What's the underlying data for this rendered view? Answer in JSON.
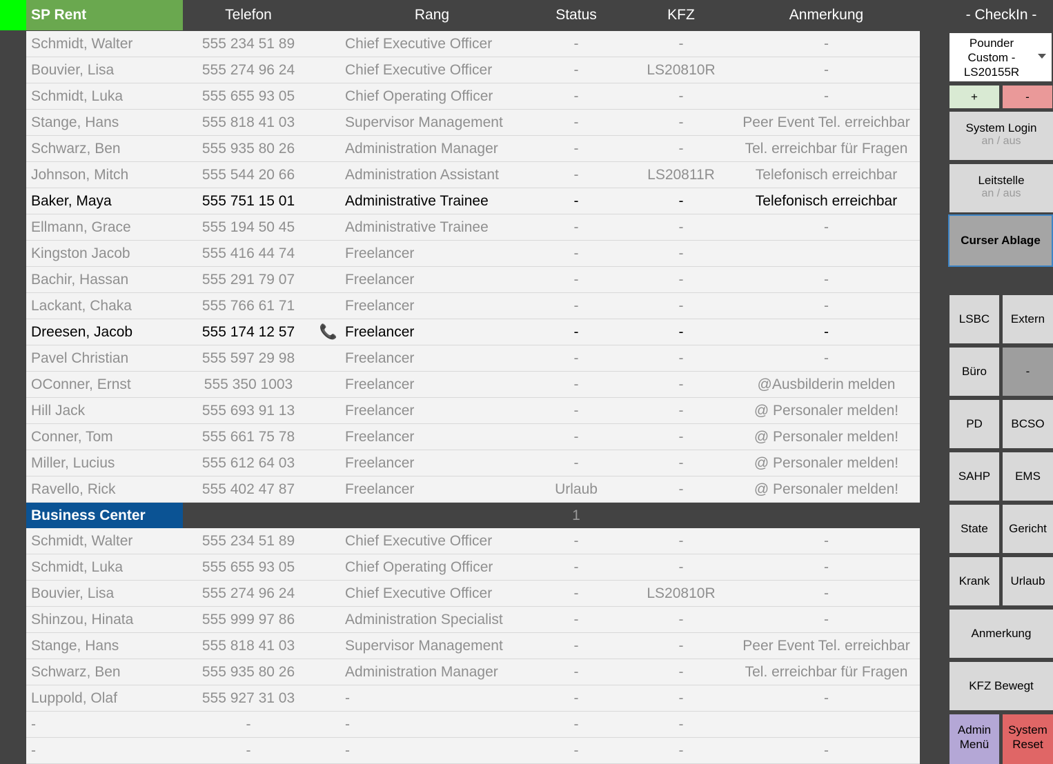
{
  "header": {
    "brand": "SP Rent",
    "columns": [
      "Telefon",
      "Rang",
      "Status",
      "KFZ",
      "Anmerkung"
    ]
  },
  "sp_rows": [
    {
      "name": "Schmidt, Walter",
      "tel": "555 234 51 89",
      "icon": "",
      "rang": "Chief Executive Officer",
      "status": "-",
      "kfz": "-",
      "note": "-",
      "active": false
    },
    {
      "name": "Bouvier, Lisa",
      "tel": "555 274 96 24",
      "icon": "",
      "rang": "Chief Executive Officer",
      "status": "-",
      "kfz": "LS20810R",
      "note": "-",
      "active": false
    },
    {
      "name": "Schmidt, Luka",
      "tel": "555 655 93 05",
      "icon": "",
      "rang": "Chief Operating Officer",
      "status": "-",
      "kfz": "-",
      "note": "-",
      "active": false
    },
    {
      "name": "Stange, Hans",
      "tel": "555 818 41 03",
      "icon": "",
      "rang": "Supervisor Management",
      "status": "-",
      "kfz": "-",
      "note": "Peer Event Tel. erreichbar",
      "active": false
    },
    {
      "name": "Schwarz, Ben",
      "tel": "555 935 80 26",
      "icon": "",
      "rang": "Administration Manager",
      "status": "-",
      "kfz": "-",
      "note": "Tel. erreichbar für Fragen",
      "active": false
    },
    {
      "name": "Johnson, Mitch",
      "tel": "555 544 20 66",
      "icon": "",
      "rang": "Administration Assistant",
      "status": "-",
      "kfz": "LS20811R",
      "note": "Telefonisch erreichbar",
      "active": false
    },
    {
      "name": "Baker, Maya",
      "tel": "555 751 15 01",
      "icon": "",
      "rang": "Administrative Trainee",
      "status": "-",
      "kfz": "-",
      "note": "Telefonisch erreichbar",
      "active": true
    },
    {
      "name": "Ellmann, Grace",
      "tel": "555 194 50 45",
      "icon": "",
      "rang": "Administrative Trainee",
      "status": "-",
      "kfz": "-",
      "note": "-",
      "active": false
    },
    {
      "name": "Kingston Jacob",
      "tel": "555 416 44 74",
      "icon": "",
      "rang": "Freelancer",
      "status": "-",
      "kfz": "-",
      "note": "",
      "active": false
    },
    {
      "name": "Bachir, Hassan",
      "tel": "555 291 79 07",
      "icon": "",
      "rang": "Freelancer",
      "status": "-",
      "kfz": "-",
      "note": "-",
      "active": false
    },
    {
      "name": "Lackant, Chaka",
      "tel": "555 766 61 71",
      "icon": "",
      "rang": "Freelancer",
      "status": "-",
      "kfz": "-",
      "note": "-",
      "active": false
    },
    {
      "name": "Dreesen, Jacob",
      "tel": "555 174 12 57",
      "icon": "📞",
      "rang": "Freelancer",
      "status": "-",
      "kfz": "-",
      "note": "-",
      "active": true
    },
    {
      "name": "Pavel Christian",
      "tel": "555 597 29 98",
      "icon": "",
      "rang": "Freelancer",
      "status": "-",
      "kfz": "-",
      "note": "-",
      "active": false
    },
    {
      "name": "OConner, Ernst",
      "tel": "555 350 1003",
      "icon": "",
      "rang": "Freelancer",
      "status": "-",
      "kfz": "-",
      "note": "@Ausbilderin melden",
      "active": false
    },
    {
      "name": "Hill Jack",
      "tel": "555 693 91 13",
      "icon": "",
      "rang": "Freelancer",
      "status": "-",
      "kfz": "-",
      "note": "@ Personaler melden!",
      "active": false
    },
    {
      "name": "Conner, Tom",
      "tel": "555 661 75 78",
      "icon": "",
      "rang": "Freelancer",
      "status": "-",
      "kfz": "-",
      "note": "@ Personaler melden!",
      "active": false
    },
    {
      "name": "Miller, Lucius",
      "tel": "555 612 64 03",
      "icon": "",
      "rang": "Freelancer",
      "status": "-",
      "kfz": "-",
      "note": "@ Personaler melden!",
      "active": false
    },
    {
      "name": "Ravello, Rick",
      "tel": "555 402 47 87",
      "icon": "",
      "rang": "Freelancer",
      "status": "Urlaub",
      "kfz": "-",
      "note": "@ Personaler melden!",
      "active": false
    }
  ],
  "bc_section": {
    "title": "Business Center",
    "count": "1"
  },
  "bc_rows": [
    {
      "name": "Schmidt, Walter",
      "tel": "555 234 51 89",
      "icon": "",
      "rang": "Chief Executive Officer",
      "status": "-",
      "kfz": "-",
      "note": "-",
      "active": false
    },
    {
      "name": "Schmidt, Luka",
      "tel": "555 655 93 05",
      "icon": "",
      "rang": "Chief Operating Officer",
      "status": "-",
      "kfz": "-",
      "note": "-",
      "active": false
    },
    {
      "name": "Bouvier, Lisa",
      "tel": "555 274 96 24",
      "icon": "",
      "rang": "Chief Executive Officer",
      "status": "-",
      "kfz": "LS20810R",
      "note": "-",
      "active": false
    },
    {
      "name": "Shinzou, Hinata",
      "tel": "555 999 97 86",
      "icon": "",
      "rang": "Administration Specialist",
      "status": "-",
      "kfz": "-",
      "note": "-",
      "active": false
    },
    {
      "name": "Stange, Hans",
      "tel": "555 818 41 03",
      "icon": "",
      "rang": "Supervisor Management",
      "status": "-",
      "kfz": "-",
      "note": "Peer Event Tel. erreichbar",
      "active": false
    },
    {
      "name": "Schwarz, Ben",
      "tel": "555 935 80 26",
      "icon": "",
      "rang": "Administration Manager",
      "status": "-",
      "kfz": "-",
      "note": "Tel. erreichbar für Fragen",
      "active": false
    },
    {
      "name": "Luppold, Olaf",
      "tel": "555 927 31 03",
      "icon": "",
      "rang": "-",
      "status": "-",
      "kfz": "-",
      "note": "-",
      "active": false
    },
    {
      "name": "-",
      "tel": "-",
      "icon": "",
      "rang": "-",
      "status": "-",
      "kfz": "-",
      "note": "",
      "active": false
    },
    {
      "name": "-",
      "tel": "-",
      "icon": "",
      "rang": "-",
      "status": "-",
      "kfz": "-",
      "note": "-",
      "active": false
    }
  ],
  "panel": {
    "title": "- CheckIn -",
    "vehicle_select": "Pounder Custom - LS20155R",
    "add_label": "+",
    "remove_label": "-",
    "system_login": {
      "label": "System Login",
      "sub": "an / aus"
    },
    "leitstelle": {
      "label": "Leitstelle",
      "sub": "an / aus"
    },
    "curser_ablage": "Curser Ablage",
    "grid": [
      [
        "LSBC",
        "Extern"
      ],
      [
        "Büro",
        "-"
      ],
      [
        "PD",
        "BCSO"
      ],
      [
        "SAHP",
        "EMS"
      ],
      [
        "State",
        "Gericht"
      ],
      [
        "Krank",
        "Urlaub"
      ]
    ],
    "anmerkung": "Anmerkung",
    "kfz_bewegt": "KFZ Bewegt",
    "admin_menu": "Admin Menü",
    "system_reset": "System Reset"
  },
  "colors": {
    "sp_brand": "#6aa84f",
    "bc_brand": "#0b5394",
    "indicator": "#00ff00",
    "add": "#d9ead3",
    "remove": "#ea9999",
    "admin": "#b4a7d6",
    "reset": "#e06666"
  }
}
